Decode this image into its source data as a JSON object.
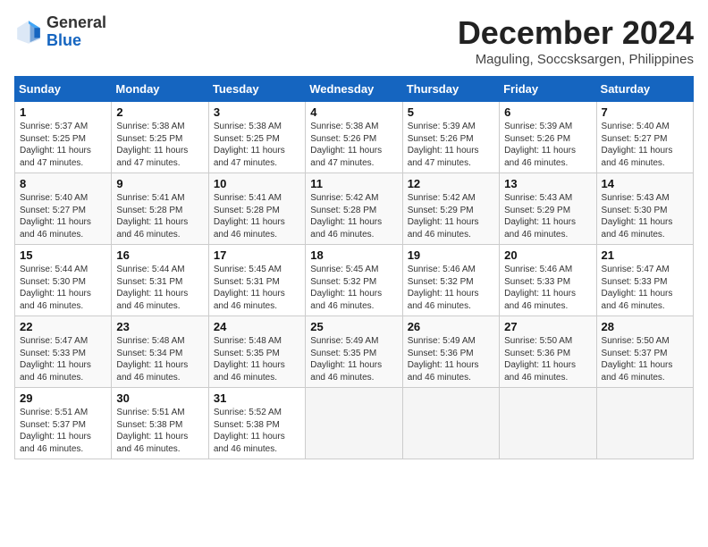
{
  "header": {
    "logo_general": "General",
    "logo_blue": "Blue",
    "month_year": "December 2024",
    "location": "Maguling, Soccsksargen, Philippines"
  },
  "weekdays": [
    "Sunday",
    "Monday",
    "Tuesday",
    "Wednesday",
    "Thursday",
    "Friday",
    "Saturday"
  ],
  "weeks": [
    [
      {
        "day": 1,
        "sunrise": "5:37 AM",
        "sunset": "5:25 PM",
        "daylight": "11 hours and 47 minutes."
      },
      {
        "day": 2,
        "sunrise": "5:38 AM",
        "sunset": "5:25 PM",
        "daylight": "11 hours and 47 minutes."
      },
      {
        "day": 3,
        "sunrise": "5:38 AM",
        "sunset": "5:25 PM",
        "daylight": "11 hours and 47 minutes."
      },
      {
        "day": 4,
        "sunrise": "5:38 AM",
        "sunset": "5:26 PM",
        "daylight": "11 hours and 47 minutes."
      },
      {
        "day": 5,
        "sunrise": "5:39 AM",
        "sunset": "5:26 PM",
        "daylight": "11 hours and 47 minutes."
      },
      {
        "day": 6,
        "sunrise": "5:39 AM",
        "sunset": "5:26 PM",
        "daylight": "11 hours and 46 minutes."
      },
      {
        "day": 7,
        "sunrise": "5:40 AM",
        "sunset": "5:27 PM",
        "daylight": "11 hours and 46 minutes."
      }
    ],
    [
      {
        "day": 8,
        "sunrise": "5:40 AM",
        "sunset": "5:27 PM",
        "daylight": "11 hours and 46 minutes."
      },
      {
        "day": 9,
        "sunrise": "5:41 AM",
        "sunset": "5:28 PM",
        "daylight": "11 hours and 46 minutes."
      },
      {
        "day": 10,
        "sunrise": "5:41 AM",
        "sunset": "5:28 PM",
        "daylight": "11 hours and 46 minutes."
      },
      {
        "day": 11,
        "sunrise": "5:42 AM",
        "sunset": "5:28 PM",
        "daylight": "11 hours and 46 minutes."
      },
      {
        "day": 12,
        "sunrise": "5:42 AM",
        "sunset": "5:29 PM",
        "daylight": "11 hours and 46 minutes."
      },
      {
        "day": 13,
        "sunrise": "5:43 AM",
        "sunset": "5:29 PM",
        "daylight": "11 hours and 46 minutes."
      },
      {
        "day": 14,
        "sunrise": "5:43 AM",
        "sunset": "5:30 PM",
        "daylight": "11 hours and 46 minutes."
      }
    ],
    [
      {
        "day": 15,
        "sunrise": "5:44 AM",
        "sunset": "5:30 PM",
        "daylight": "11 hours and 46 minutes."
      },
      {
        "day": 16,
        "sunrise": "5:44 AM",
        "sunset": "5:31 PM",
        "daylight": "11 hours and 46 minutes."
      },
      {
        "day": 17,
        "sunrise": "5:45 AM",
        "sunset": "5:31 PM",
        "daylight": "11 hours and 46 minutes."
      },
      {
        "day": 18,
        "sunrise": "5:45 AM",
        "sunset": "5:32 PM",
        "daylight": "11 hours and 46 minutes."
      },
      {
        "day": 19,
        "sunrise": "5:46 AM",
        "sunset": "5:32 PM",
        "daylight": "11 hours and 46 minutes."
      },
      {
        "day": 20,
        "sunrise": "5:46 AM",
        "sunset": "5:33 PM",
        "daylight": "11 hours and 46 minutes."
      },
      {
        "day": 21,
        "sunrise": "5:47 AM",
        "sunset": "5:33 PM",
        "daylight": "11 hours and 46 minutes."
      }
    ],
    [
      {
        "day": 22,
        "sunrise": "5:47 AM",
        "sunset": "5:33 PM",
        "daylight": "11 hours and 46 minutes."
      },
      {
        "day": 23,
        "sunrise": "5:48 AM",
        "sunset": "5:34 PM",
        "daylight": "11 hours and 46 minutes."
      },
      {
        "day": 24,
        "sunrise": "5:48 AM",
        "sunset": "5:35 PM",
        "daylight": "11 hours and 46 minutes."
      },
      {
        "day": 25,
        "sunrise": "5:49 AM",
        "sunset": "5:35 PM",
        "daylight": "11 hours and 46 minutes."
      },
      {
        "day": 26,
        "sunrise": "5:49 AM",
        "sunset": "5:36 PM",
        "daylight": "11 hours and 46 minutes."
      },
      {
        "day": 27,
        "sunrise": "5:50 AM",
        "sunset": "5:36 PM",
        "daylight": "11 hours and 46 minutes."
      },
      {
        "day": 28,
        "sunrise": "5:50 AM",
        "sunset": "5:37 PM",
        "daylight": "11 hours and 46 minutes."
      }
    ],
    [
      {
        "day": 29,
        "sunrise": "5:51 AM",
        "sunset": "5:37 PM",
        "daylight": "11 hours and 46 minutes."
      },
      {
        "day": 30,
        "sunrise": "5:51 AM",
        "sunset": "5:38 PM",
        "daylight": "11 hours and 46 minutes."
      },
      {
        "day": 31,
        "sunrise": "5:52 AM",
        "sunset": "5:38 PM",
        "daylight": "11 hours and 46 minutes."
      },
      null,
      null,
      null,
      null
    ]
  ]
}
